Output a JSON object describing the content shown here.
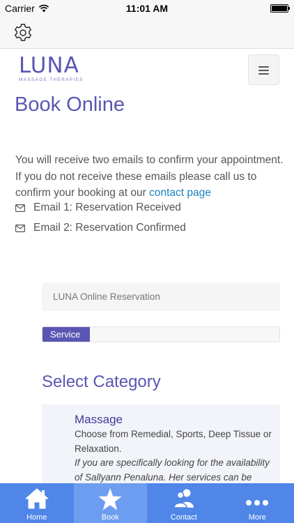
{
  "status_bar": {
    "carrier": "Carrier",
    "time": "11:01 AM"
  },
  "toolbar": {
    "settings_icon": "gear-icon"
  },
  "header": {
    "logo_word": "LUNA",
    "logo_tagline": "MASSAGE THERAPIES",
    "menu_icon": "hamburger-menu-icon"
  },
  "page": {
    "title": "Book Online",
    "intro_text": "You will receive two emails to confirm your appointment. If you do not receive these emails please call us to confirm your booking at our ",
    "intro_link": "contact page",
    "emails": [
      {
        "icon": "envelope-icon",
        "label": "Email 1: Reservation Received"
      },
      {
        "icon": "envelope-icon",
        "label": "Email 2: Reservation Confirmed"
      }
    ]
  },
  "booking": {
    "heading": "LUNA Online Reservation",
    "progress_step": "Service",
    "progress_fraction": 0.2,
    "section_title": "Select Category",
    "categories": [
      {
        "name": "Massage",
        "description": "Choose from Remedial, Sports, Deep Tissue or Relaxation.",
        "note": "If you are specifically looking for the availability of Sallyann Penaluna. Her services can be"
      }
    ]
  },
  "tabs": [
    {
      "label": "Home",
      "icon": "home-icon",
      "active": false
    },
    {
      "label": "Book",
      "icon": "star-icon",
      "active": true
    },
    {
      "label": "Contact",
      "icon": "people-icon",
      "active": false
    },
    {
      "label": "More",
      "icon": "more-dots-icon",
      "active": false
    }
  ],
  "colors": {
    "brand": "#5b56b3",
    "link": "#1a80c0",
    "tab_bar": "#4f86e8",
    "tab_active": "#6d9df0"
  }
}
